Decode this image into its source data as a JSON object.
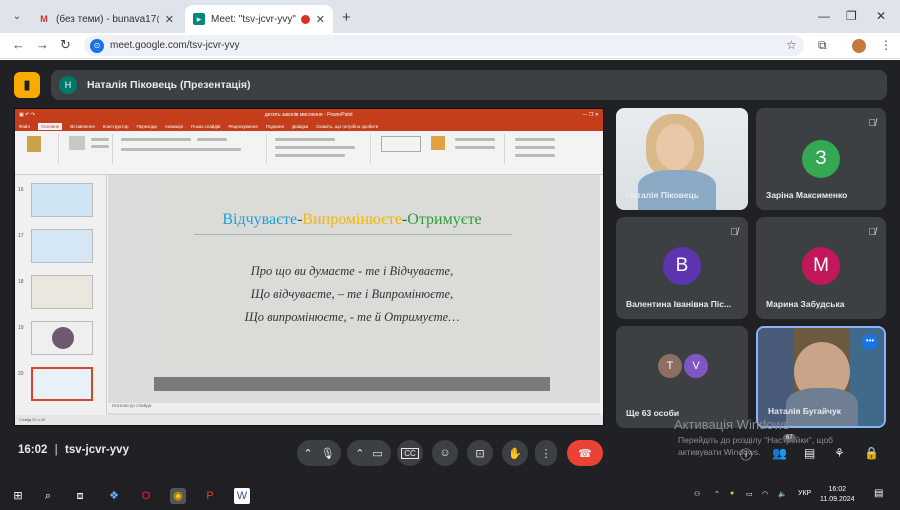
{
  "browser": {
    "tabs": [
      {
        "title": "(без теми) - bunava17@gmail.",
        "favicon": "gmail-icon"
      },
      {
        "title": "Meet: \"tsv-jcvr-yvy\"",
        "favicon": "meet-icon",
        "active": true
      }
    ],
    "url": "meet.google.com/tsv-jcvr-yvy"
  },
  "meet": {
    "presenter_label": "Наталія Піковець (Презентація)",
    "presenter_initial": "Н",
    "meeting_time": "16:02",
    "meeting_code": "tsv-jcvr-yvy",
    "participants": [
      {
        "name": "Наталія Піковець",
        "type": "video"
      },
      {
        "name": "Заріна Максименко",
        "initial": "З",
        "color": "#34a853",
        "muted": true
      },
      {
        "name": "Валентина Іванівна Піс...",
        "initial": "В",
        "color": "#5e35b1",
        "muted": true
      },
      {
        "name": "Марина Забудська",
        "initial": "М",
        "color": "#c2185b",
        "muted": true
      },
      {
        "name": "Ще 63 особи",
        "initials": [
          "Т",
          "V"
        ],
        "colors": [
          "#8d6e63",
          "#7e57c2"
        ]
      },
      {
        "name": "Наталія Бугайчук",
        "type": "video"
      }
    ],
    "activation": {
      "title": "Активація Windows",
      "text": "Перейдіть до розділу \"Настройки\", щоб активувати Windows."
    },
    "people_badge": "67"
  },
  "presentation": {
    "app_title": "десять законів мислення - PowerPoint",
    "ribbon_tabs": [
      "Файл",
      "Основне",
      "Вставлення",
      "Конструктор",
      "Переходи",
      "Анімація",
      "Показ слайдів",
      "Рецензування",
      "Подання",
      "Довідка",
      "Скажіть, що потрібно зробити"
    ],
    "slide_numbers": [
      "16",
      "17",
      "18",
      "19",
      "20"
    ],
    "slide": {
      "title_part1": "Відчуваєте",
      "title_part2": "Випромінюєте",
      "title_part3": "Отримуєте",
      "lines": [
        "Про що ви думаєте  - те і Відчуваєте,",
        "Що відчуваєте, – те і Випромінюєте,",
        "Що випромінюєте, - те й Отримуєте…"
      ]
    },
    "notes_placeholder": "Нотатки до слайда",
    "status": "Слайд 20 з 20"
  },
  "taskbar": {
    "lang": "УКР",
    "time": "16:02",
    "date": "11.09.2024"
  }
}
